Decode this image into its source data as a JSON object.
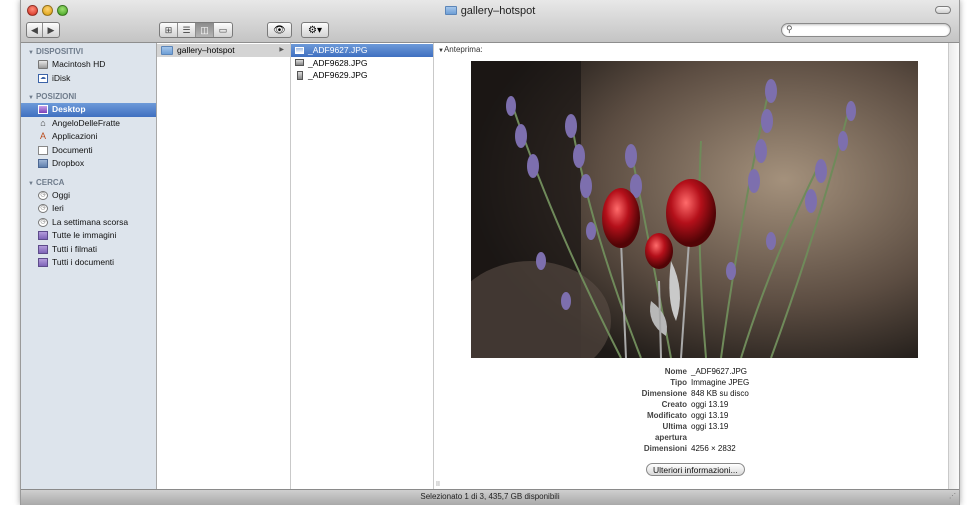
{
  "window": {
    "title": "gallery–hotspot"
  },
  "toolbar": {
    "back": "◀",
    "forward": "▶",
    "view_icons": "⊞",
    "view_list": "☰",
    "view_columns": "◫",
    "view_coverflow": "▭",
    "quicklook": "👁",
    "action": "⚙▾",
    "search_placeholder": ""
  },
  "sidebar": {
    "sections": [
      {
        "title": "DISPOSITIVI",
        "items": [
          {
            "label": "Macintosh HD",
            "icon": "hard-disk-icon"
          },
          {
            "label": "iDisk",
            "icon": "idisk-icon"
          }
        ]
      },
      {
        "title": "POSIZIONI",
        "items": [
          {
            "label": "Desktop",
            "icon": "desktop-icon",
            "selected": true
          },
          {
            "label": "AngeloDelleFratte",
            "icon": "home-icon"
          },
          {
            "label": "Applicazioni",
            "icon": "applications-icon"
          },
          {
            "label": "Documenti",
            "icon": "documents-icon"
          },
          {
            "label": "Dropbox",
            "icon": "folder-icon"
          }
        ]
      },
      {
        "title": "CERCA",
        "items": [
          {
            "label": "Oggi",
            "icon": "clock-icon"
          },
          {
            "label": "Ieri",
            "icon": "clock-icon"
          },
          {
            "label": "La settimana scorsa",
            "icon": "clock-icon"
          },
          {
            "label": "Tutte le immagini",
            "icon": "smart-folder-icon"
          },
          {
            "label": "Tutti i filmati",
            "icon": "smart-folder-icon"
          },
          {
            "label": "Tutti i documenti",
            "icon": "smart-folder-icon"
          }
        ]
      }
    ]
  },
  "columns": {
    "col1": [
      {
        "label": "gallery–hotspot",
        "arrow": "▶"
      }
    ],
    "col2": [
      {
        "label": "_ADF9627.JPG"
      },
      {
        "label": "_ADF9628.JPG"
      },
      {
        "label": "_ADF9629.JPG"
      }
    ]
  },
  "preview": {
    "header": "Anteprima:",
    "info": [
      {
        "key": "Nome",
        "value": "_ADF9627.JPG"
      },
      {
        "key": "Tipo",
        "value": "Immagine JPEG"
      },
      {
        "key": "Dimensione",
        "value": "848 KB su disco"
      },
      {
        "key": "Creato",
        "value": "oggi 13.19"
      },
      {
        "key": "Modificato",
        "value": "oggi 13.19"
      },
      {
        "key": "Ultima",
        "value": "oggi 13.19"
      },
      {
        "key": "apertura",
        "value": ""
      },
      {
        "key": "Dimensioni",
        "value": "4256 × 2832"
      }
    ],
    "more_button": "Ulteriori informazioni..."
  },
  "statusbar": {
    "text": "Selezionato 1 di 3, 435,7 GB disponibili"
  }
}
